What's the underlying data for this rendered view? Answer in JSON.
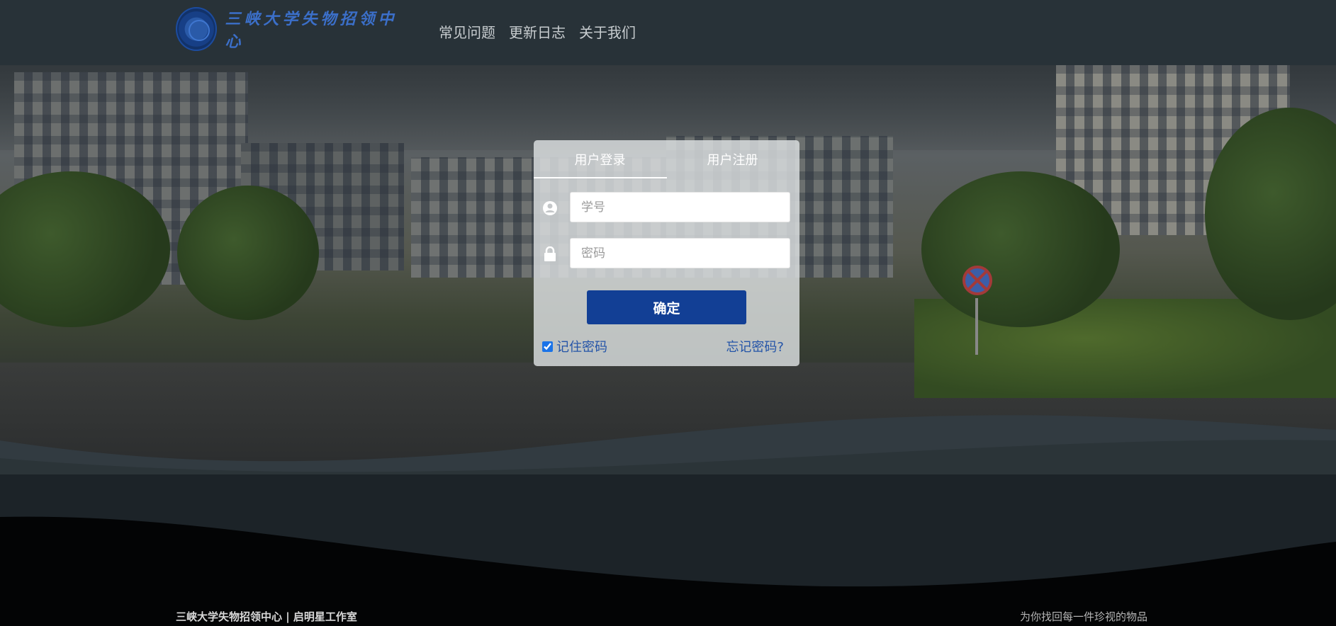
{
  "header": {
    "logo_text": "三峡大学失物招领中心",
    "nav": [
      "常见问题",
      "更新日志",
      "关于我们"
    ]
  },
  "login": {
    "tabs": [
      "用户登录",
      "用户注册"
    ],
    "active_tab": "用户登录",
    "student_id_placeholder": "学号",
    "password_placeholder": "密码",
    "confirm_label": "确定",
    "remember_label": "记住密码",
    "remember_checked": true,
    "forgot_label": "忘记密码?"
  },
  "footer": {
    "left_text": "三峡大学失物招领中心 | 启明星工作室",
    "right_text": "为你找回每一件珍视的物品"
  },
  "colors": {
    "header_bg": "#283238",
    "primary_button": "#123f95",
    "link": "#2454a8"
  },
  "icons": [
    "university-logo-icon",
    "user-icon",
    "lock-icon"
  ]
}
